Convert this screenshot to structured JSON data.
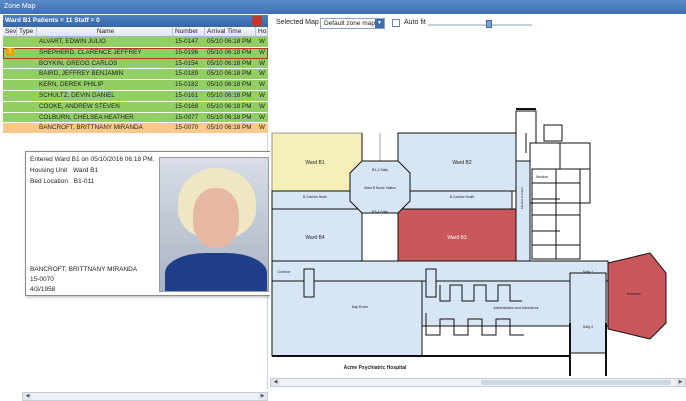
{
  "window": {
    "title": "Zone Map"
  },
  "ward_panel": {
    "header": "Ward B1  Patients = 11  Staff = 0",
    "columns": [
      "Sev",
      "Type",
      "Name",
      "Number",
      "Arrival Time",
      "Ho"
    ],
    "rows": [
      {
        "name": "ALVART, EDWIN JULIO",
        "number": "15-0147",
        "arrival": "05/10 06:18 PM",
        "ho": "W",
        "color": "green",
        "warn": false
      },
      {
        "name": "SHEPHERD, CLARENCE JEFFREY",
        "number": "15-0196",
        "arrival": "05/10 06:18 PM",
        "ho": "W",
        "color": "green",
        "warn": true
      },
      {
        "name": "BOYKIN, GREGG CARLOS",
        "number": "15-0154",
        "arrival": "05/10 06:18 PM",
        "ho": "W",
        "color": "green",
        "warn": false
      },
      {
        "name": "BAIRD, JEFFREY BENJAMIN",
        "number": "15-0189",
        "arrival": "05/10 06:18 PM",
        "ho": "W",
        "color": "green",
        "warn": false
      },
      {
        "name": "KERN, DEREK PHILIP",
        "number": "15-0182",
        "arrival": "05/10 06:18 PM",
        "ho": "W",
        "color": "green",
        "warn": false
      },
      {
        "name": "SCHULTZ, DEVIN DANIEL",
        "number": "15-0161",
        "arrival": "05/10 06:18 PM",
        "ho": "W",
        "color": "green",
        "warn": false
      },
      {
        "name": "COOKE, ANDREW STEVEN",
        "number": "15-0168",
        "arrival": "05/10 06:18 PM",
        "ho": "W",
        "color": "green",
        "warn": false
      },
      {
        "name": "COLBURN, CHELSEA HEATHER",
        "number": "15-0077",
        "arrival": "05/10 06:18 PM",
        "ho": "W",
        "color": "green",
        "warn": false
      },
      {
        "name": "BANCROFT, BRITTNANY MIRANDA",
        "number": "15-0070",
        "arrival": "05/10 06:18 PM",
        "ho": "W",
        "color": "orange",
        "warn": false
      }
    ],
    "warn_glyph": "!"
  },
  "popup": {
    "entered": "Entered Ward B1 on 05/10/2016 06:18 PM.",
    "housing_label": "Housing Unit",
    "housing_value": "Ward B1",
    "bed_label": "Bed Location",
    "bed_value": "B1-011",
    "name": "BANCROFT, BRITTNANY MIRANDA",
    "number": "15-0070",
    "dob": "4/3/1958"
  },
  "map_toolbar": {
    "selected_map_label": "Selected Map",
    "selected_map_value": "Default zone map",
    "auto_fit_label": "Auto fit",
    "zoom_fraction": 0.56
  },
  "map": {
    "labels": {
      "ward_b1": "Ward B1",
      "ward_b2": "Ward B2",
      "ward_b3": "Ward B3",
      "ward_b4": "Ward B4",
      "b12_sally": "B1-2 Sally",
      "b34_sally": "B3-4 Sally",
      "nurse_station": "Ward B Nurse Station",
      "corridor_north": "B Corridor North",
      "corridor_south": "B Corridor South",
      "medical": "Medical",
      "medical_corridor": "Medical Corridor",
      "day_room": "Day Room",
      "admin": "Administration and Admissions",
      "entrance": "Entrance",
      "sally1": "Sally 1",
      "sally2": "Sally 2",
      "corridor": "Corridor",
      "hospital": "Acme Psychiatric Hospital"
    },
    "colors": {
      "ward_b1": "#f6f0b8",
      "ward_b3": "#c9575c",
      "entrance": "#c9575c",
      "floor": "#d7e6f5"
    }
  }
}
